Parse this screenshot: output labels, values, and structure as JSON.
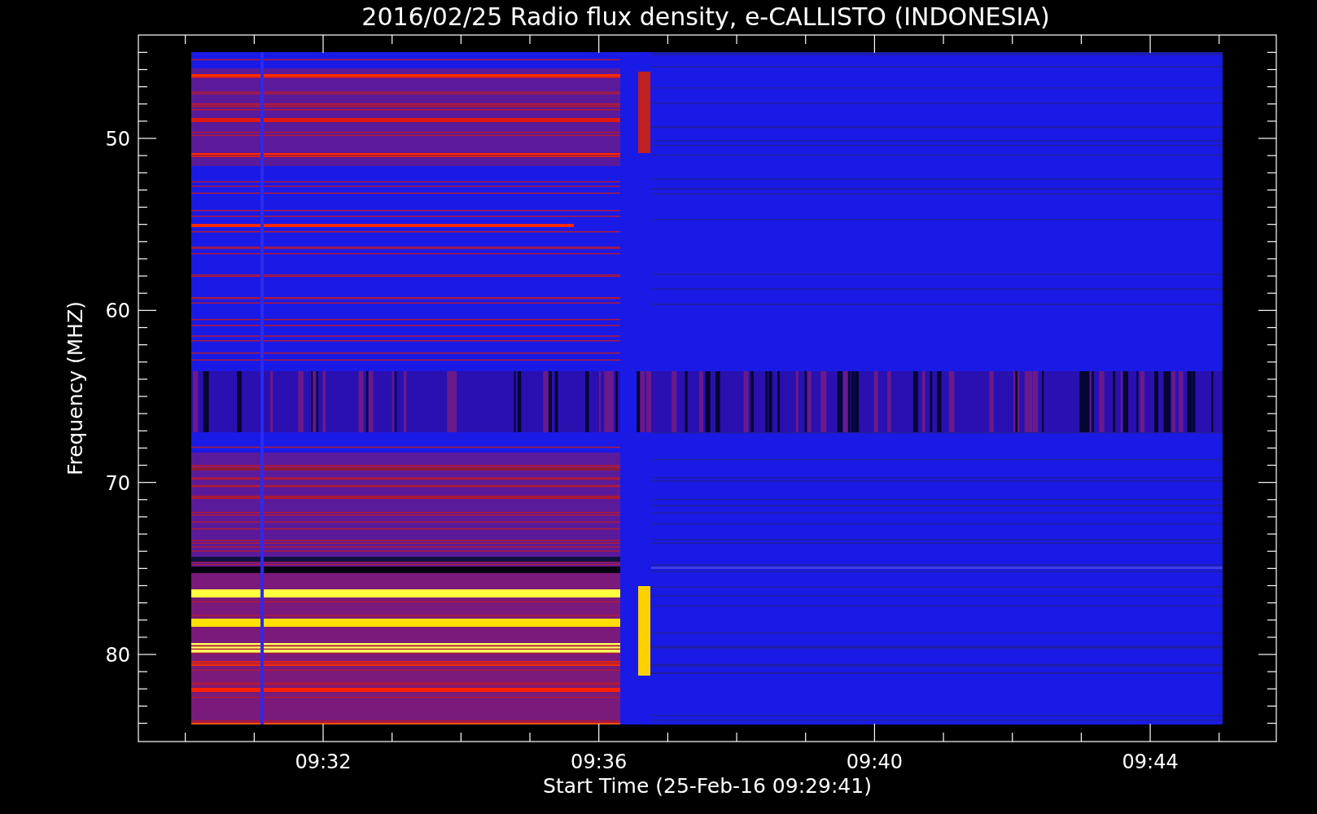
{
  "title": "2016/02/25  Radio flux density, e-CALLISTO (INDONESIA)",
  "y_axis": {
    "label": "Frequency (MHZ)",
    "tick_labels": [
      "50",
      "60",
      "70",
      "80"
    ]
  },
  "x_axis": {
    "label": "Start Time (25-Feb-16 09:29:41)",
    "tick_labels": [
      "09:32",
      "09:36",
      "09:40",
      "09:44"
    ]
  }
}
